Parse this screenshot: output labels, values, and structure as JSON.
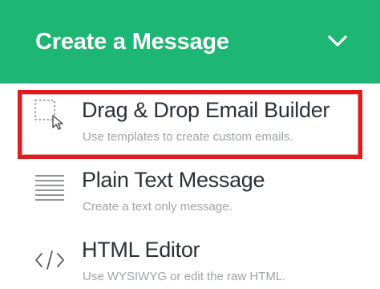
{
  "header": {
    "title": "Create a Message",
    "toggle_icon": "chevron-down-icon",
    "background_color": "#1db675"
  },
  "menu": {
    "items": [
      {
        "title": "Drag & Drop Email Builder",
        "description": "Use templates to create custom emails.",
        "icon": "drag-drop-icon",
        "highlighted": true
      },
      {
        "title": "Plain Text Message",
        "description": "Create a text only message.",
        "icon": "plain-text-icon"
      },
      {
        "title": "HTML Editor",
        "description": "Use WYSIWYG or edit the raw HTML.",
        "icon": "code-icon"
      }
    ]
  },
  "colors": {
    "highlight_border": "#e11b1b",
    "title_text": "#2c3038",
    "description_text": "#a0a3a8"
  }
}
